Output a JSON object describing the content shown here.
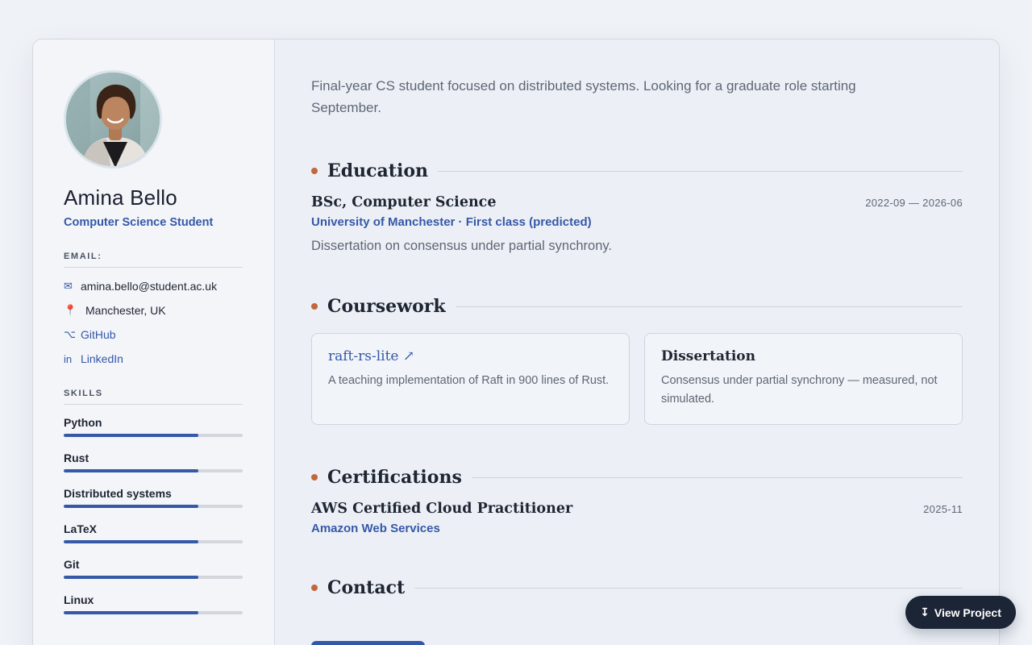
{
  "profile": {
    "name": "Amina Bello",
    "role": "Computer Science Student"
  },
  "sidebar": {
    "email_heading": "EMAIL:",
    "contacts": [
      {
        "icon": "envelope-icon",
        "glyph": "✉",
        "text": "amina.bello@student.ac.uk"
      },
      {
        "icon": "location-pin-icon",
        "glyph": "📍",
        "text": "Manchester, UK"
      },
      {
        "icon": "github-icon",
        "glyph": "⌥",
        "text": "GitHub"
      },
      {
        "icon": "linkedin-icon",
        "glyph": "in",
        "text": "LinkedIn"
      }
    ],
    "skills_heading": "SKILLS",
    "skills": [
      {
        "label": "Python",
        "level": 0.75
      },
      {
        "label": "Rust",
        "level": 0.75
      },
      {
        "label": "Distributed systems",
        "level": 0.75
      },
      {
        "label": "LaTeX",
        "level": 0.75
      },
      {
        "label": "Git",
        "level": 0.75
      },
      {
        "label": "Linux",
        "level": 0.75
      }
    ]
  },
  "summary": "Final-year CS student focused on distributed systems. Looking for a graduate role starting September.",
  "education": {
    "heading": "Education",
    "title": "BSc, Computer Science",
    "dates": "2022-09 — 2026-06",
    "institution": "University of Manchester · First class (predicted)",
    "description": "Dissertation on consensus under partial synchrony."
  },
  "coursework": {
    "heading": "Coursework",
    "items": [
      {
        "title": "raft-rs-lite ↗",
        "description": "A teaching implementation of Raft in 900 lines of Rust."
      },
      {
        "title": "Dissertation",
        "description": "Consensus under partial synchrony — measured, not simulated."
      }
    ]
  },
  "certifications": {
    "heading": "Certifications",
    "title": "AWS Certified Cloud Practitioner",
    "date": "2025-11",
    "issuer": "Amazon Web Services"
  },
  "contact": {
    "heading": "Contact"
  },
  "fab": {
    "arrow": "↧",
    "label": "View Project"
  },
  "colors": {
    "accent": "#3558a8",
    "dot": "#c0683c",
    "fab_bg": "#1c2536"
  }
}
